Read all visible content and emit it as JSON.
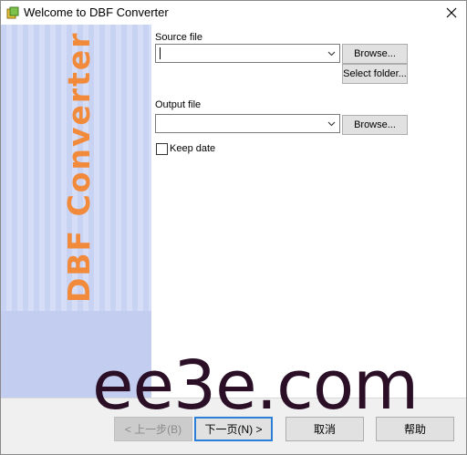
{
  "window": {
    "title": "Welcome to DBF Converter",
    "close_icon": "close-icon",
    "app_icon": "dbf-app-icon"
  },
  "sidebar": {
    "brand_text": "DBF Converter",
    "brand_color": "#f28a3c",
    "background_color": "#c3cdef"
  },
  "source": {
    "label": "Source file",
    "value": "",
    "browse_label": "Browse...",
    "select_folder_label": "Select folder..."
  },
  "output": {
    "label": "Output file",
    "value": "",
    "browse_label": "Browse..."
  },
  "keep_date": {
    "label": "Keep date",
    "checked": false
  },
  "nav": {
    "back_label": "< 上一步(B)",
    "next_label": "下一页(N) >",
    "cancel_label": "取消",
    "help_label": "帮助"
  },
  "watermark": {
    "text": "ee3e.com"
  }
}
